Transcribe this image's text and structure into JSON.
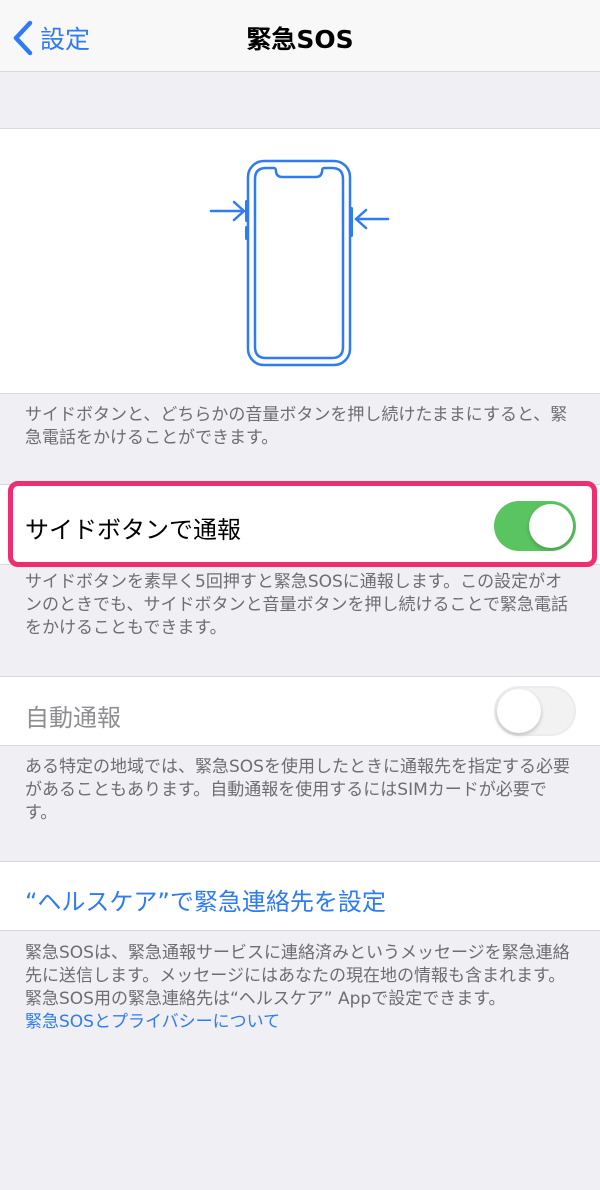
{
  "nav": {
    "back_label": "設定",
    "title": "緊急SOS"
  },
  "illustration": {
    "icon": "iphone-side-buttons-icon",
    "accent_color": "#2f7bf5"
  },
  "intro_footnote": "サイドボタンと、どちらかの音量ボタンを押し続けたままにすると、緊急電話をかけることができます。",
  "side_button_row": {
    "label": "サイドボタンで通報",
    "toggle_on": true,
    "toggle_color": "#5ac461"
  },
  "side_button_footnote": "サイドボタンを素早く5回押すと緊急SOSに通報します。この設定がオンのときでも、サイドボタンと音量ボタンを押し続けることで緊急電話をかけることもできます。",
  "auto_call_row": {
    "label": "自動通報",
    "toggle_on": false
  },
  "auto_call_footnote": "ある特定の地域では、緊急SOSを使用したときに通報先を指定する必要があることもあります。自動通報を使用するにはSIMカードが必要です。",
  "health_link_row": {
    "label": "“ヘルスケア”で緊急連絡先を設定"
  },
  "bottom_footnote": {
    "text": "緊急SOSは、緊急通報サービスに連絡済みというメッセージを緊急連絡先に送信します。メッセージにはあなたの現在地の情報も含まれます。緊急SOS用の緊急連絡先は“ヘルスケア” Appで設定できます。",
    "link": "緊急SOSとプライバシーについて"
  },
  "highlight_color": "#ef2e6f"
}
